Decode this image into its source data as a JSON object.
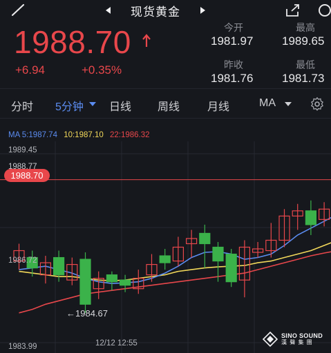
{
  "header": {
    "title": "现货黄金",
    "back_icon": "back-arrow-icon",
    "prev_icon": "triangle-left-icon",
    "next_icon": "triangle-right-icon",
    "share_icon": "share-icon",
    "search_icon": "search-icon"
  },
  "quote": {
    "price": "1988.70",
    "direction_icon": "up-arrow-icon",
    "change": "+6.94",
    "change_percent": "+0.35%",
    "color_up": "#e8474b"
  },
  "stats": {
    "open_label": "今开",
    "open": "1981.97",
    "high_label": "最高",
    "high": "1989.65",
    "prev_close_label": "昨收",
    "prev_close": "1981.76",
    "low_label": "最低",
    "low": "1981.73"
  },
  "tabs": {
    "items": [
      "分时",
      "5分钟",
      "日线",
      "周线",
      "月线",
      "MA"
    ],
    "active": "5分钟",
    "settings_icon": "gear-icon"
  },
  "ma_legend": {
    "ma5": "MA 5:1987.74",
    "ma10": "10:1987.10",
    "ma22": "22:1986.32",
    "ma5_color": "#5b8cf0",
    "ma10_color": "#f2d85a",
    "ma22_color": "#e8474b"
  },
  "chart_data": {
    "type": "candlestick",
    "y_ticks": [
      "1989.45",
      "1988.77",
      "1986.72",
      "1983.99"
    ],
    "ylim": [
      1983.99,
      1989.45
    ],
    "x_tick": "12/12 12:55",
    "current_price_tag": "1988.70",
    "min_marker": "←1984.67",
    "candles": [
      {
        "o": 1986.35,
        "c": 1986.65,
        "h": 1986.85,
        "l": 1986.1
      },
      {
        "o": 1986.45,
        "c": 1986.15,
        "h": 1986.65,
        "l": 1985.9
      },
      {
        "o": 1985.95,
        "c": 1986.3,
        "h": 1986.5,
        "l": 1985.7
      },
      {
        "o": 1986.45,
        "c": 1985.95,
        "h": 1986.65,
        "l": 1985.75
      },
      {
        "o": 1985.8,
        "c": 1986.25,
        "h": 1986.45,
        "l": 1985.65
      },
      {
        "o": 1986.4,
        "c": 1985.1,
        "h": 1986.6,
        "l": 1984.85
      },
      {
        "o": 1985.55,
        "c": 1985.85,
        "h": 1986.05,
        "l": 1985.25
      },
      {
        "o": 1985.95,
        "c": 1985.75,
        "h": 1986.05,
        "l": 1985.5
      },
      {
        "o": 1985.8,
        "c": 1985.65,
        "h": 1985.95,
        "l": 1985.45
      },
      {
        "o": 1985.55,
        "c": 1985.85,
        "h": 1986.1,
        "l": 1985.4
      },
      {
        "o": 1985.95,
        "c": 1986.25,
        "h": 1986.55,
        "l": 1985.75
      },
      {
        "o": 1986.5,
        "c": 1986.3,
        "h": 1986.7,
        "l": 1986.1
      },
      {
        "o": 1986.35,
        "c": 1986.75,
        "h": 1987.05,
        "l": 1986.2
      },
      {
        "o": 1986.85,
        "c": 1987.0,
        "h": 1987.25,
        "l": 1986.45
      },
      {
        "o": 1987.15,
        "c": 1986.85,
        "h": 1987.4,
        "l": 1986.15
      },
      {
        "o": 1986.75,
        "c": 1986.35,
        "h": 1986.9,
        "l": 1985.75
      },
      {
        "o": 1986.55,
        "c": 1985.75,
        "h": 1986.7,
        "l": 1985.6
      },
      {
        "o": 1985.8,
        "c": 1986.75,
        "h": 1986.95,
        "l": 1985.3
      },
      {
        "o": 1986.6,
        "c": 1986.7,
        "h": 1986.9,
        "l": 1986.45
      },
      {
        "o": 1986.65,
        "c": 1986.95,
        "h": 1987.45,
        "l": 1986.45
      },
      {
        "o": 1986.95,
        "c": 1987.65,
        "h": 1987.85,
        "l": 1986.75
      },
      {
        "o": 1987.65,
        "c": 1987.8,
        "h": 1988.0,
        "l": 1987.25
      },
      {
        "o": 1987.8,
        "c": 1987.4,
        "h": 1988.1,
        "l": 1987.1
      },
      {
        "o": 1987.55,
        "c": 1987.85,
        "h": 1988.05,
        "l": 1987.35
      },
      {
        "o": 1987.85,
        "c": 1987.95,
        "h": 1988.05,
        "l": 1987.7
      },
      {
        "o": 1987.95,
        "c": 1988.1,
        "h": 1988.3,
        "l": 1987.75
      },
      {
        "o": 1988.0,
        "c": 1988.2,
        "h": 1988.55,
        "l": 1987.9
      },
      {
        "o": 1988.2,
        "c": 1988.7,
        "h": 1988.75,
        "l": 1988.05
      }
    ],
    "ma5": [
      1986.1,
      1986.15,
      1986.2,
      1986.1,
      1986.0,
      1985.85,
      1985.75,
      1985.7,
      1985.72,
      1985.75,
      1985.85,
      1986.0,
      1986.2,
      1986.45,
      1986.6,
      1986.62,
      1986.55,
      1986.4,
      1986.45,
      1986.55,
      1986.8,
      1987.1,
      1987.3,
      1987.5,
      1987.7,
      1987.8,
      1987.95,
      1988.1
    ],
    "ma10": [
      1986.05,
      1986.0,
      1985.95,
      1985.9,
      1985.9,
      1985.85,
      1985.8,
      1985.78,
      1985.8,
      1985.85,
      1985.9,
      1985.95,
      1986.05,
      1986.1,
      1986.15,
      1986.18,
      1986.2,
      1986.22,
      1986.3,
      1986.35,
      1986.45,
      1986.55,
      1986.65,
      1986.8,
      1986.95,
      1987.1,
      1987.25,
      1987.45
    ],
    "ma22": [
      1984.85,
      1984.95,
      1985.1,
      1985.2,
      1985.3,
      1985.4,
      1985.45,
      1985.5,
      1985.55,
      1985.6,
      1985.65,
      1985.7,
      1985.75,
      1985.8,
      1985.85,
      1985.9,
      1985.95,
      1986.0,
      1986.1,
      1986.2,
      1986.3,
      1986.4,
      1986.5,
      1986.58,
      1986.65,
      1986.72,
      1986.8,
      1986.9
    ],
    "up_color": "#e8474b",
    "down_color": "#3bb24a",
    "grid": true
  },
  "watermark": {
    "line1": "SINO SOUND",
    "line2": "漢 聲 集 團"
  }
}
